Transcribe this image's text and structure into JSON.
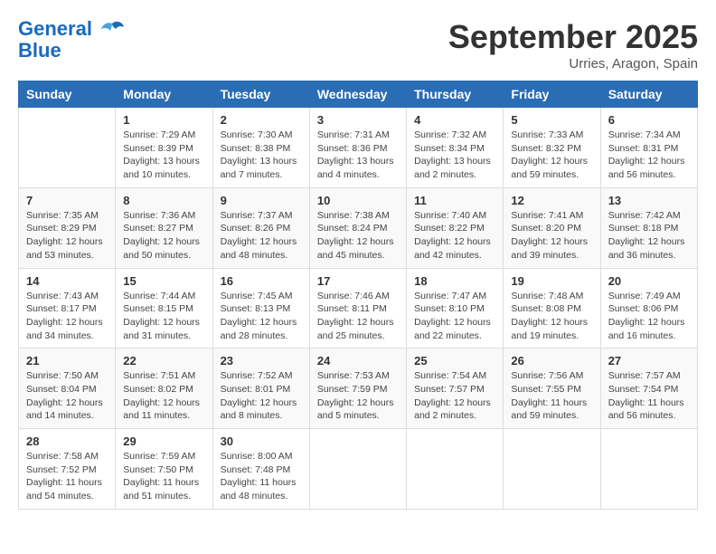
{
  "header": {
    "logo_line1": "General",
    "logo_line2": "Blue",
    "month_title": "September 2025",
    "location": "Urries, Aragon, Spain"
  },
  "days_of_week": [
    "Sunday",
    "Monday",
    "Tuesday",
    "Wednesday",
    "Thursday",
    "Friday",
    "Saturday"
  ],
  "weeks": [
    [
      {
        "day": "",
        "sunrise": "",
        "sunset": "",
        "daylight": ""
      },
      {
        "day": "1",
        "sunrise": "Sunrise: 7:29 AM",
        "sunset": "Sunset: 8:39 PM",
        "daylight": "Daylight: 13 hours and 10 minutes."
      },
      {
        "day": "2",
        "sunrise": "Sunrise: 7:30 AM",
        "sunset": "Sunset: 8:38 PM",
        "daylight": "Daylight: 13 hours and 7 minutes."
      },
      {
        "day": "3",
        "sunrise": "Sunrise: 7:31 AM",
        "sunset": "Sunset: 8:36 PM",
        "daylight": "Daylight: 13 hours and 4 minutes."
      },
      {
        "day": "4",
        "sunrise": "Sunrise: 7:32 AM",
        "sunset": "Sunset: 8:34 PM",
        "daylight": "Daylight: 13 hours and 2 minutes."
      },
      {
        "day": "5",
        "sunrise": "Sunrise: 7:33 AM",
        "sunset": "Sunset: 8:32 PM",
        "daylight": "Daylight: 12 hours and 59 minutes."
      },
      {
        "day": "6",
        "sunrise": "Sunrise: 7:34 AM",
        "sunset": "Sunset: 8:31 PM",
        "daylight": "Daylight: 12 hours and 56 minutes."
      }
    ],
    [
      {
        "day": "7",
        "sunrise": "Sunrise: 7:35 AM",
        "sunset": "Sunset: 8:29 PM",
        "daylight": "Daylight: 12 hours and 53 minutes."
      },
      {
        "day": "8",
        "sunrise": "Sunrise: 7:36 AM",
        "sunset": "Sunset: 8:27 PM",
        "daylight": "Daylight: 12 hours and 50 minutes."
      },
      {
        "day": "9",
        "sunrise": "Sunrise: 7:37 AM",
        "sunset": "Sunset: 8:26 PM",
        "daylight": "Daylight: 12 hours and 48 minutes."
      },
      {
        "day": "10",
        "sunrise": "Sunrise: 7:38 AM",
        "sunset": "Sunset: 8:24 PM",
        "daylight": "Daylight: 12 hours and 45 minutes."
      },
      {
        "day": "11",
        "sunrise": "Sunrise: 7:40 AM",
        "sunset": "Sunset: 8:22 PM",
        "daylight": "Daylight: 12 hours and 42 minutes."
      },
      {
        "day": "12",
        "sunrise": "Sunrise: 7:41 AM",
        "sunset": "Sunset: 8:20 PM",
        "daylight": "Daylight: 12 hours and 39 minutes."
      },
      {
        "day": "13",
        "sunrise": "Sunrise: 7:42 AM",
        "sunset": "Sunset: 8:18 PM",
        "daylight": "Daylight: 12 hours and 36 minutes."
      }
    ],
    [
      {
        "day": "14",
        "sunrise": "Sunrise: 7:43 AM",
        "sunset": "Sunset: 8:17 PM",
        "daylight": "Daylight: 12 hours and 34 minutes."
      },
      {
        "day": "15",
        "sunrise": "Sunrise: 7:44 AM",
        "sunset": "Sunset: 8:15 PM",
        "daylight": "Daylight: 12 hours and 31 minutes."
      },
      {
        "day": "16",
        "sunrise": "Sunrise: 7:45 AM",
        "sunset": "Sunset: 8:13 PM",
        "daylight": "Daylight: 12 hours and 28 minutes."
      },
      {
        "day": "17",
        "sunrise": "Sunrise: 7:46 AM",
        "sunset": "Sunset: 8:11 PM",
        "daylight": "Daylight: 12 hours and 25 minutes."
      },
      {
        "day": "18",
        "sunrise": "Sunrise: 7:47 AM",
        "sunset": "Sunset: 8:10 PM",
        "daylight": "Daylight: 12 hours and 22 minutes."
      },
      {
        "day": "19",
        "sunrise": "Sunrise: 7:48 AM",
        "sunset": "Sunset: 8:08 PM",
        "daylight": "Daylight: 12 hours and 19 minutes."
      },
      {
        "day": "20",
        "sunrise": "Sunrise: 7:49 AM",
        "sunset": "Sunset: 8:06 PM",
        "daylight": "Daylight: 12 hours and 16 minutes."
      }
    ],
    [
      {
        "day": "21",
        "sunrise": "Sunrise: 7:50 AM",
        "sunset": "Sunset: 8:04 PM",
        "daylight": "Daylight: 12 hours and 14 minutes."
      },
      {
        "day": "22",
        "sunrise": "Sunrise: 7:51 AM",
        "sunset": "Sunset: 8:02 PM",
        "daylight": "Daylight: 12 hours and 11 minutes."
      },
      {
        "day": "23",
        "sunrise": "Sunrise: 7:52 AM",
        "sunset": "Sunset: 8:01 PM",
        "daylight": "Daylight: 12 hours and 8 minutes."
      },
      {
        "day": "24",
        "sunrise": "Sunrise: 7:53 AM",
        "sunset": "Sunset: 7:59 PM",
        "daylight": "Daylight: 12 hours and 5 minutes."
      },
      {
        "day": "25",
        "sunrise": "Sunrise: 7:54 AM",
        "sunset": "Sunset: 7:57 PM",
        "daylight": "Daylight: 12 hours and 2 minutes."
      },
      {
        "day": "26",
        "sunrise": "Sunrise: 7:56 AM",
        "sunset": "Sunset: 7:55 PM",
        "daylight": "Daylight: 11 hours and 59 minutes."
      },
      {
        "day": "27",
        "sunrise": "Sunrise: 7:57 AM",
        "sunset": "Sunset: 7:54 PM",
        "daylight": "Daylight: 11 hours and 56 minutes."
      }
    ],
    [
      {
        "day": "28",
        "sunrise": "Sunrise: 7:58 AM",
        "sunset": "Sunset: 7:52 PM",
        "daylight": "Daylight: 11 hours and 54 minutes."
      },
      {
        "day": "29",
        "sunrise": "Sunrise: 7:59 AM",
        "sunset": "Sunset: 7:50 PM",
        "daylight": "Daylight: 11 hours and 51 minutes."
      },
      {
        "day": "30",
        "sunrise": "Sunrise: 8:00 AM",
        "sunset": "Sunset: 7:48 PM",
        "daylight": "Daylight: 11 hours and 48 minutes."
      },
      {
        "day": "",
        "sunrise": "",
        "sunset": "",
        "daylight": ""
      },
      {
        "day": "",
        "sunrise": "",
        "sunset": "",
        "daylight": ""
      },
      {
        "day": "",
        "sunrise": "",
        "sunset": "",
        "daylight": ""
      },
      {
        "day": "",
        "sunrise": "",
        "sunset": "",
        "daylight": ""
      }
    ]
  ]
}
